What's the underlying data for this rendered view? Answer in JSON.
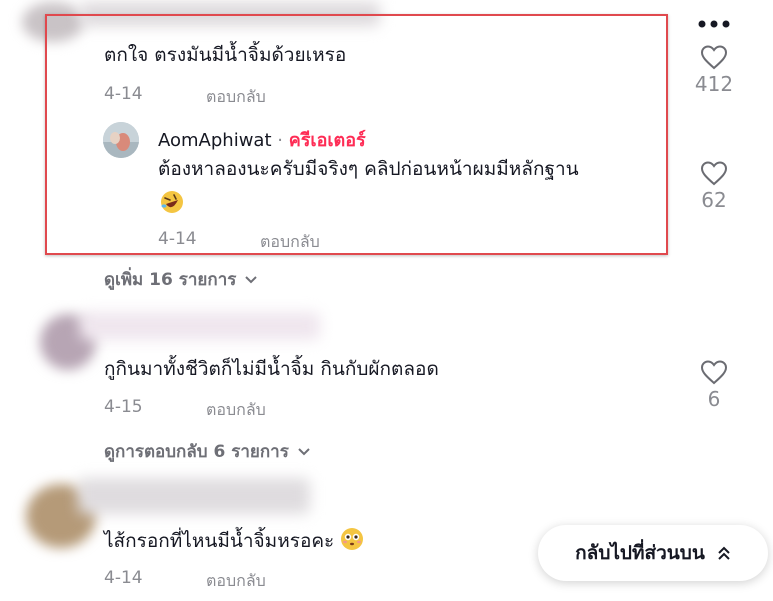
{
  "comments": [
    {
      "text": "ตกใจ ตรงมันมีน้ำจิ้มด้วยเหรอ",
      "date": "4-14",
      "reply_label": "ตอบกลับ",
      "likes": "412",
      "reply": {
        "username": "AomAphiwat",
        "separator": "·",
        "badge": "ครีเอเตอร์",
        "text": "ต้องหาลองนะครับมีจริงๆ คลิปก่อนหน้าผมมีหลักฐาน",
        "emoji": "rofl-emoji",
        "date": "4-14",
        "reply_label": "ตอบกลับ",
        "likes": "62"
      },
      "view_more": "ดูเพิ่ม 16 รายการ"
    },
    {
      "text": "กูกินมาทั้งชีวิตก็ไม่มีน้ำจิ้ม กินกับผักตลอด",
      "date": "4-15",
      "reply_label": "ตอบกลับ",
      "likes": "6",
      "view_more": "ดูการตอบกลับ 6 รายการ"
    },
    {
      "text": "ไส้กรอกที่ไหนมีน้ำจิ้มหรอคะ",
      "emoji": "flushed-emoji",
      "date": "4-14",
      "reply_label": "ตอบกลับ"
    }
  ],
  "back_to_top": {
    "label": "กลับไปที่ส่วนบน",
    "icon": "double-chevron-up-icon"
  },
  "menu_icon": "more-dots-icon",
  "colors": {
    "highlight": "#e0494e",
    "creator_badge": "#fe2c55",
    "muted": "#8a8b91"
  }
}
